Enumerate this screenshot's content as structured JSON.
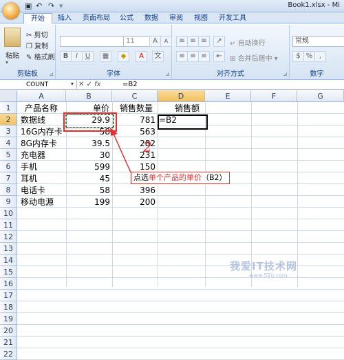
{
  "window": {
    "title": "Book1.xlsx - Mi"
  },
  "tabs": [
    "开始",
    "插入",
    "页面布局",
    "公式",
    "数据",
    "审阅",
    "视图",
    "开发工具"
  ],
  "ribbon": {
    "clipboard": {
      "label": "剪贴板",
      "paste": "粘贴",
      "cut": "剪切",
      "copy": "复制",
      "format_painter": "格式刷"
    },
    "font": {
      "label": "字体",
      "size": "11"
    },
    "alignment": {
      "label": "对齐方式",
      "wrap": "自动换行",
      "merge": "合并后居中"
    },
    "number": {
      "label": "数字",
      "format": "常规"
    }
  },
  "formula_bar": {
    "name_box": "COUNT",
    "fx": "fx",
    "formula": "=B2"
  },
  "columns": [
    "A",
    "B",
    "C",
    "D",
    "E",
    "F",
    "G"
  ],
  "rows": [
    "1",
    "2",
    "3",
    "4",
    "5",
    "6",
    "7",
    "8",
    "9",
    "10",
    "11",
    "12",
    "13",
    "14",
    "15",
    "16",
    "17",
    "18",
    "19",
    "20",
    "21",
    "22"
  ],
  "cells": {
    "header": {
      "a": "产品名称",
      "b": "单价",
      "c": "销售数量",
      "d": "销售额"
    },
    "data": [
      {
        "a": "数据线",
        "b": "29.9",
        "c": "781",
        "d": "=B2"
      },
      {
        "a": "16G内存卡",
        "b": "58",
        "c": "563",
        "d": ""
      },
      {
        "a": "8G内存卡",
        "b": "39.5",
        "c": "282",
        "d": ""
      },
      {
        "a": "充电器",
        "b": "30",
        "c": "231",
        "d": ""
      },
      {
        "a": "手机",
        "b": "599",
        "c": "150",
        "d": ""
      },
      {
        "a": "耳机",
        "b": "45",
        "c": "",
        "d": ""
      },
      {
        "a": "电话卡",
        "b": "58",
        "c": "396",
        "d": ""
      },
      {
        "a": "移动电源",
        "b": "199",
        "c": "200",
        "d": ""
      }
    ]
  },
  "annotation": {
    "step": "2",
    "callout_prefix": "点选",
    "callout_highlight": "单个产品的单价",
    "callout_suffix": "（B2）",
    "color": "#e03030"
  },
  "watermark": {
    "main": "我爱IT技术网",
    "sub": "www.52ij.com"
  }
}
